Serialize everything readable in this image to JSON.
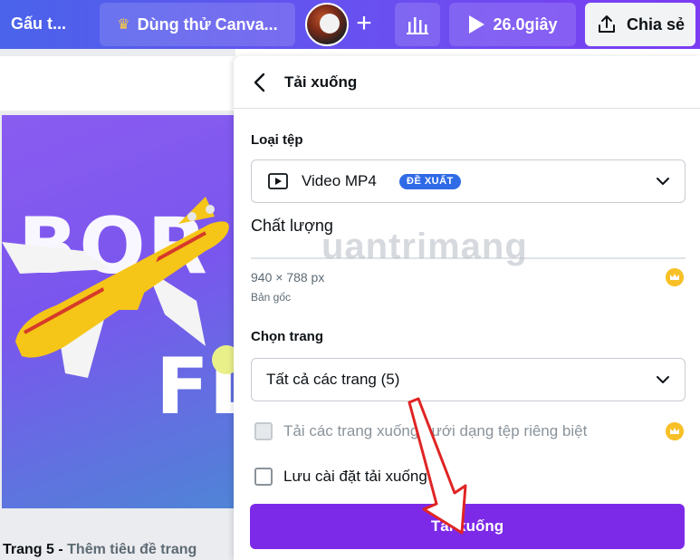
{
  "topbar": {
    "title": "Gấu t...",
    "trial_label": "Dùng thử Canva...",
    "timer_label": "26.0giây",
    "share_label": "Chia sẻ"
  },
  "canvas": {
    "design_text_top": "BOR",
    "design_text_bottom": "FL",
    "page_number": "Trang 5 -",
    "page_title_placeholder": "Thêm tiêu đề trang"
  },
  "download_panel": {
    "title": "Tải xuống",
    "file_type_label": "Loại tệp",
    "file_type_value": "Video MP4",
    "recommended_badge": "ĐỀ XUẤT",
    "quality_label": "Chất lượng",
    "dimensions": "940 × 788 px",
    "dimensions_note": "Bản gốc",
    "pages_label": "Chọn trang",
    "pages_value": "Tất cả các trang (5)",
    "separate_files_label": "Tải các trang xuống dưới dạng tệp riêng biệt",
    "save_settings_label": "Lưu cài đặt tải xuống",
    "download_button": "Tải xuống"
  },
  "watermark": "uantrimang",
  "colors": {
    "topbar_start": "#4a63ea",
    "topbar_end": "#7b3cf2",
    "primary_button": "#7d2ae8",
    "badge": "#2f6be6",
    "crown": "#f8c027",
    "arrow": "#e02424"
  }
}
